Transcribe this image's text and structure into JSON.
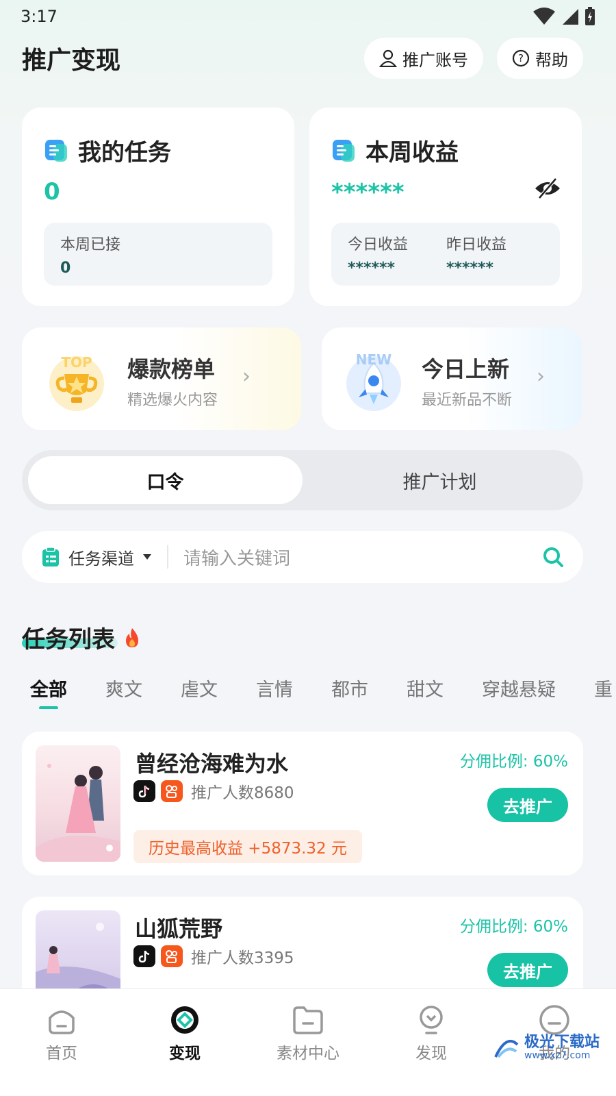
{
  "status_bar": {
    "time": "3:17"
  },
  "header": {
    "title": "推广变现",
    "account_button": "推广账号",
    "help_button": "帮助"
  },
  "my_tasks": {
    "title": "我的任务",
    "count": "0",
    "week_accepted_label": "本周已接",
    "week_accepted_value": "0"
  },
  "weekly_earnings": {
    "title": "本周收益",
    "masked_value": "******",
    "today_label": "今日收益",
    "today_value": "******",
    "yesterday_label": "昨日收益",
    "yesterday_value": "******"
  },
  "promo_cards": [
    {
      "title": "爆款榜单",
      "subtitle": "精选爆火内容",
      "badge": "TOP"
    },
    {
      "title": "今日上新",
      "subtitle": "最近新品不断",
      "badge": "NEW"
    }
  ],
  "segment": {
    "tabs": [
      "口令",
      "推广计划"
    ],
    "active_index": 0
  },
  "search": {
    "channel_label": "任务渠道",
    "placeholder": "请输入关键词"
  },
  "task_list": {
    "title": "任务列表",
    "tabs": [
      "全部",
      "爽文",
      "虐文",
      "言情",
      "都市",
      "甜文",
      "穿越悬疑",
      "重"
    ],
    "active_tab": 0,
    "items": [
      {
        "name": "曾经沧海难为水",
        "promoter_count": "推广人数8680",
        "ratio": "分佣比例: 60%",
        "action": "去推广",
        "max_earning": "历史最高收益 +5873.32 元"
      },
      {
        "name": "山狐荒野",
        "promoter_count": "推广人数3395",
        "ratio": "分佣比例: 60%",
        "action": "去推广"
      }
    ]
  },
  "bottom_nav": {
    "items": [
      "首页",
      "变现",
      "素材中心",
      "发现",
      "我的"
    ],
    "active_index": 1
  },
  "watermark": {
    "line1": "极光下载站",
    "line2": "www.xz7.com"
  },
  "colors": {
    "accent": "#1cc3a7",
    "earn_orange": "#f0602a"
  }
}
